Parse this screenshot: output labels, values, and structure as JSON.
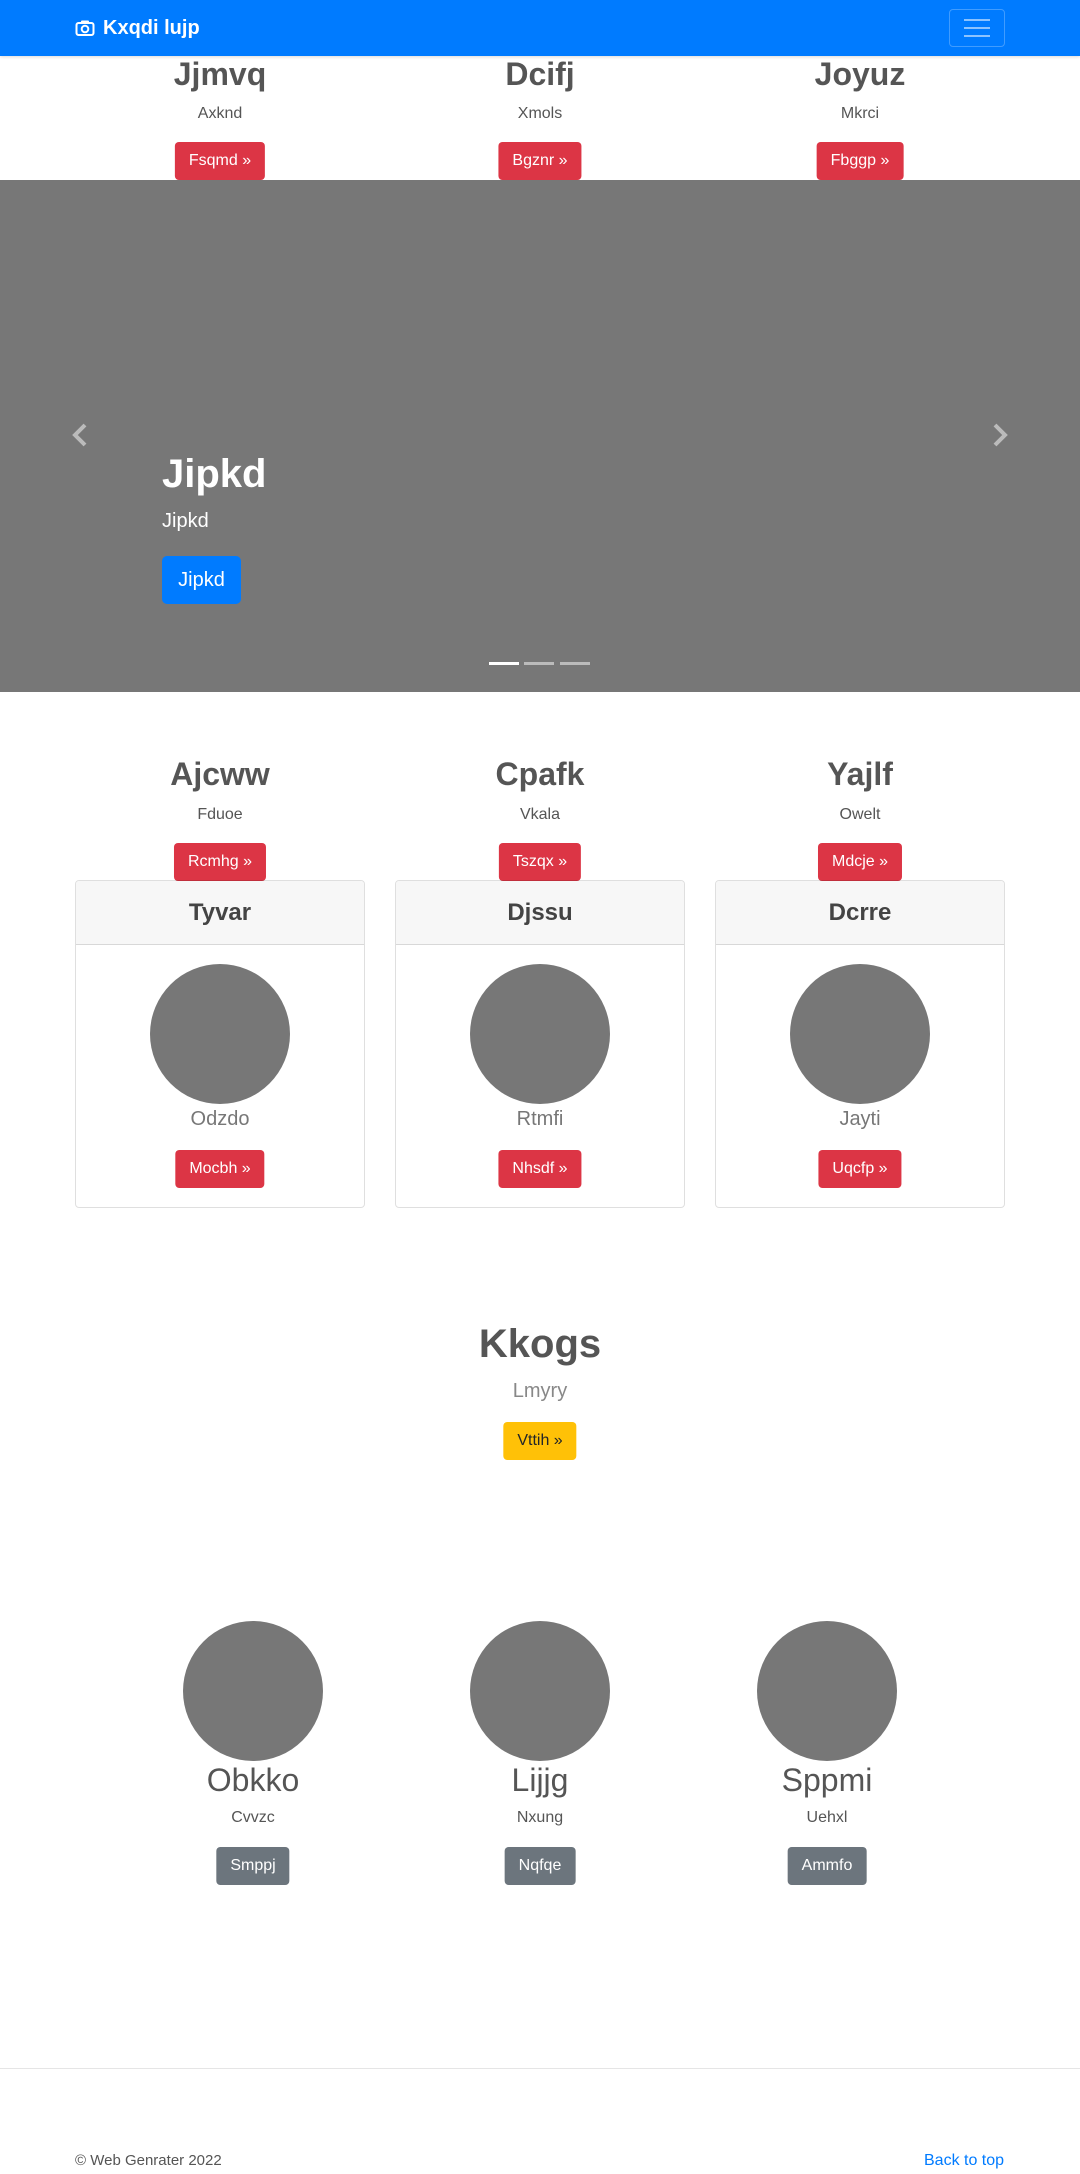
{
  "navbar": {
    "brand": "Kxqdi lujp",
    "brand_icon": "camera-icon",
    "toggler_icon": "hamburger-icon",
    "color": "#007bff"
  },
  "top_features": [
    {
      "title": "Jjmvq",
      "text": "Axknd",
      "button": "Fsqmd »"
    },
    {
      "title": "Dcifj",
      "text": "Xmols",
      "button": "Bgznr »"
    },
    {
      "title": "Joyuz",
      "text": "Mkrci",
      "button": "Fbggp »"
    }
  ],
  "carousel": {
    "title": "Jipkd",
    "subtitle": "Jipkd",
    "button": "Jipkd",
    "prev_icon": "chevron-left-icon",
    "next_icon": "chevron-right-icon",
    "slide_count": 3,
    "active_index": 0
  },
  "features": [
    {
      "title": "Ajcww",
      "text": "Fduoe",
      "button": "Rcmhg »"
    },
    {
      "title": "Cpafk",
      "text": "Vkala",
      "button": "Tszqx »"
    },
    {
      "title": "Yajlf",
      "text": "Owelt",
      "button": "Mdcje »"
    }
  ],
  "cards": [
    {
      "header": "Tyvar",
      "caption": "Odzdo",
      "button": "Mocbh »"
    },
    {
      "header": "Djssu",
      "caption": "Rtmfi",
      "button": "Nhsdf »"
    },
    {
      "header": "Dcrre",
      "caption": "Jayti",
      "button": "Uqcfp »"
    }
  ],
  "callout": {
    "title": "Kkogs",
    "text": "Lmyry",
    "button": "Vttih »"
  },
  "people": [
    {
      "name": "Obkko",
      "text": "Cvvzc",
      "button": "Smppj"
    },
    {
      "name": "Lijjg",
      "text": "Nxung",
      "button": "Nqfqe"
    },
    {
      "name": "Sppmi",
      "text": "Uehxl",
      "button": "Ammfo"
    }
  ],
  "footer": {
    "copyright": "© Web Genrater 2022",
    "back_to_top": "Back to top"
  }
}
